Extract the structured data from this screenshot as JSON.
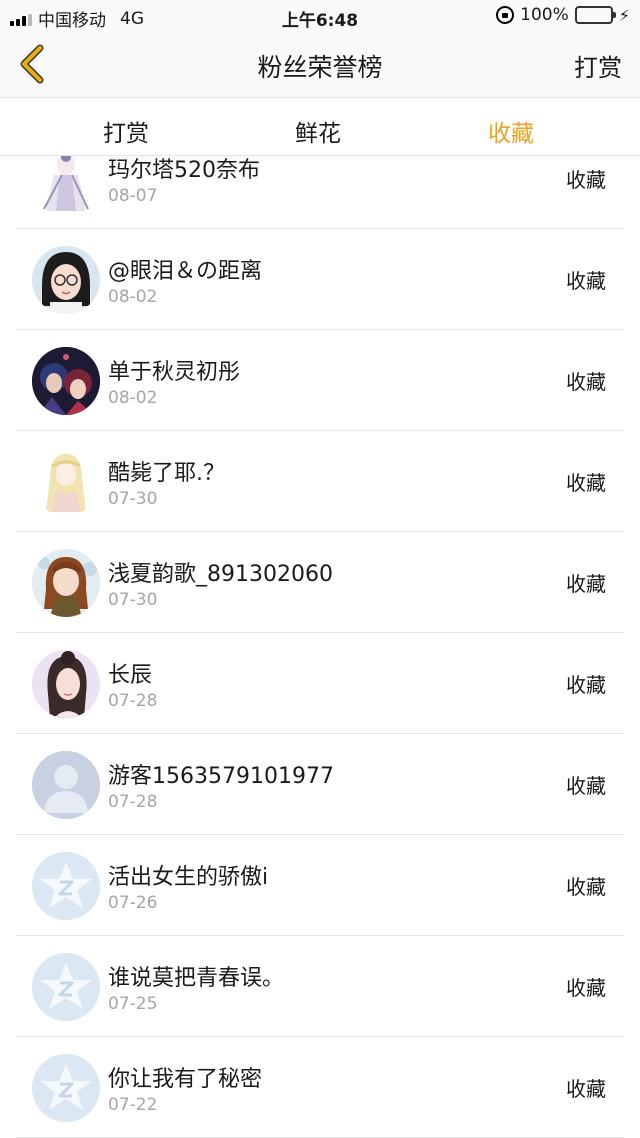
{
  "status_bar": {
    "carrier": "中国移动",
    "network": "4G",
    "time": "上午6:48",
    "battery": "100%"
  },
  "header": {
    "title": "粉丝荣誉榜",
    "action": "打赏"
  },
  "tabs": [
    {
      "label": "打赏"
    },
    {
      "label": "鲜花"
    },
    {
      "label": "收藏"
    }
  ],
  "active_tab": "收藏",
  "colors": {
    "accent": "#f0a01e",
    "back_arrow": "#e8b10e"
  },
  "fans": [
    {
      "name": "玛尔塔520奈布",
      "date": "08-07",
      "action": "收藏",
      "avatar": "anime-girl-white"
    },
    {
      "name": "@眼泪＆の距离",
      "date": "08-02",
      "action": "收藏",
      "avatar": "girl-glasses"
    },
    {
      "name": "单于秋灵初彤",
      "date": "08-02",
      "action": "收藏",
      "avatar": "dark-anime-pair"
    },
    {
      "name": "酷毙了耶.？",
      "date": "07-30",
      "action": "收藏",
      "avatar": "anime-blonde"
    },
    {
      "name": "浅夏韵歌_891302060",
      "date": "07-30",
      "action": "收藏",
      "avatar": "anime-brown-hair"
    },
    {
      "name": "长辰",
      "date": "07-28",
      "action": "收藏",
      "avatar": "girl-portrait"
    },
    {
      "name": "游客1563579101977",
      "date": "07-28",
      "action": "收藏",
      "avatar": "default-person"
    },
    {
      "name": "活出女生的骄傲i",
      "date": "07-26",
      "action": "收藏",
      "avatar": "default-star"
    },
    {
      "name": "谁说莫把青春误。",
      "date": "07-25",
      "action": "收藏",
      "avatar": "default-star"
    },
    {
      "name": "你让我有了秘密",
      "date": "07-22",
      "action": "收藏",
      "avatar": "default-star"
    }
  ]
}
